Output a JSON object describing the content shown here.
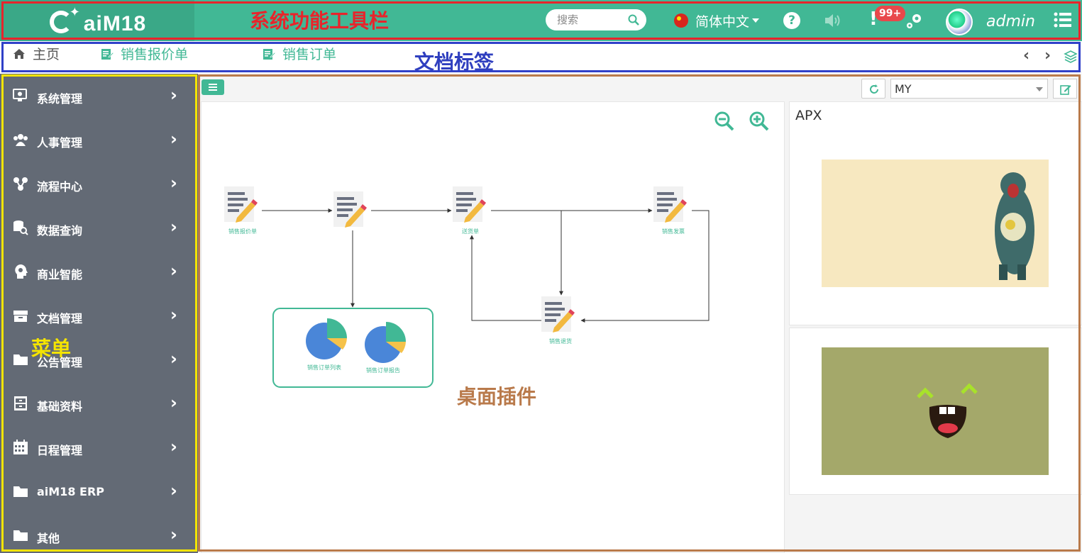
{
  "app": {
    "logo_text": "aiM18"
  },
  "annotations": {
    "toolbar": "系统功能工具栏",
    "tabs": "文档标签",
    "menu": "菜单",
    "desktop": "桌面插件"
  },
  "toolbar": {
    "search_placeholder": "搜索",
    "language": "简体中文",
    "help": "?",
    "alert_mark": "!",
    "notification_badge": "99+",
    "username": "admin"
  },
  "tabs": [
    {
      "label": "主页",
      "icon": "home-icon",
      "active": true
    },
    {
      "label": "销售报价单",
      "icon": "edit-document-icon"
    },
    {
      "label": "销售订单",
      "icon": "edit-document-icon"
    }
  ],
  "tab_nav": {
    "prev": "‹",
    "next": "›"
  },
  "sidebar": {
    "items": [
      {
        "label": "系统管理",
        "icon": "monitor-settings-icon"
      },
      {
        "label": "人事管理",
        "icon": "users-icon"
      },
      {
        "label": "流程中心",
        "icon": "workflow-icon"
      },
      {
        "label": "数据查询",
        "icon": "database-search-icon"
      },
      {
        "label": "商业智能",
        "icon": "brain-head-icon"
      },
      {
        "label": "文档管理",
        "icon": "archive-box-icon"
      },
      {
        "label": "公告管理",
        "icon": "folder-icon"
      },
      {
        "label": "基础资料",
        "icon": "drawer-icon"
      },
      {
        "label": "日程管理",
        "icon": "calendar-icon"
      },
      {
        "label": "aiM18 ERP",
        "icon": "folder-icon"
      },
      {
        "label": "其他",
        "icon": "folder-icon"
      }
    ],
    "chevron": "›"
  },
  "desktop": {
    "select_value": "MY",
    "flow": {
      "nodes": [
        {
          "label": "销售报价单"
        },
        {
          "label": ""
        },
        {
          "label": "送货单"
        },
        {
          "label": "销售发票"
        },
        {
          "label": "销售退货"
        }
      ],
      "reports": [
        {
          "label": "销售订单列表"
        },
        {
          "label": "销售订单报告"
        }
      ]
    },
    "widget_title": "APX",
    "colors": {
      "accent": "#41b895",
      "sidebar": "#636a75"
    }
  }
}
